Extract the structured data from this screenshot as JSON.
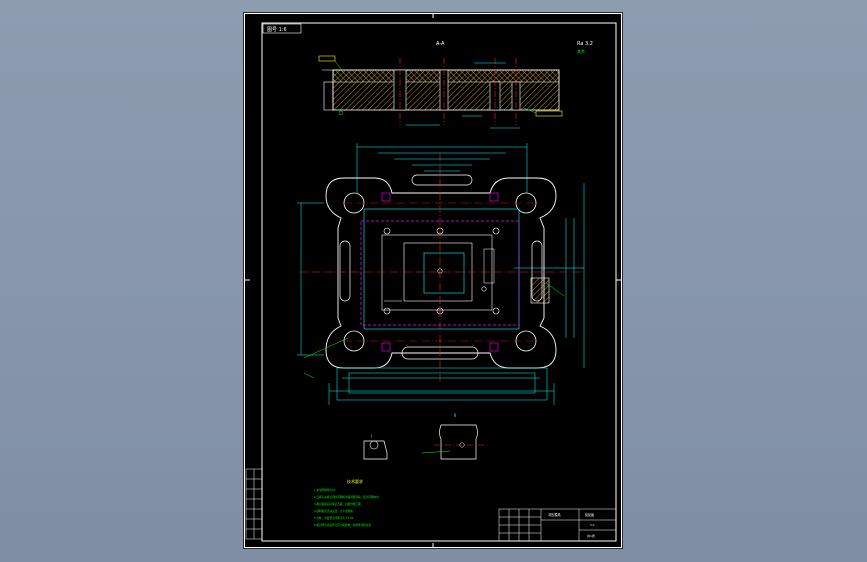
{
  "drawing": {
    "corner_tag": "图号 1:6",
    "section_label": "A-A",
    "roughness": "Ra 3.2",
    "top_label": "其余",
    "view_label": "B向",
    "detail_left": "I",
    "detail_right": "II",
    "notes_title": "技术要求",
    "notes": [
      "1.未注明倒角为C1",
      "2.凸模与凹模之间的间隙按冲裁间隙选取，配合间隙均匀",
      "3.模具装配后应保证凸模、凹模位置正确",
      "4.卸料板应活动灵活，无卡滞现象",
      "5.导柱、导套配合间隙不大于0.02",
      "6.模具闭合高度符合压力机要求，各零件紧固可靠"
    ],
    "title_block": {
      "part_name": "冲压模具",
      "drawing_no": "装配图",
      "scale": "1:1",
      "sheet": "共1张"
    }
  },
  "colors": {
    "sheet_bg": "#000000",
    "outline": "#ffffff",
    "dimension": "#00ffff",
    "centerline": "#ff2020",
    "annotation": "#00ff00",
    "hidden": "#ff00ff",
    "note": "#ffff00"
  }
}
